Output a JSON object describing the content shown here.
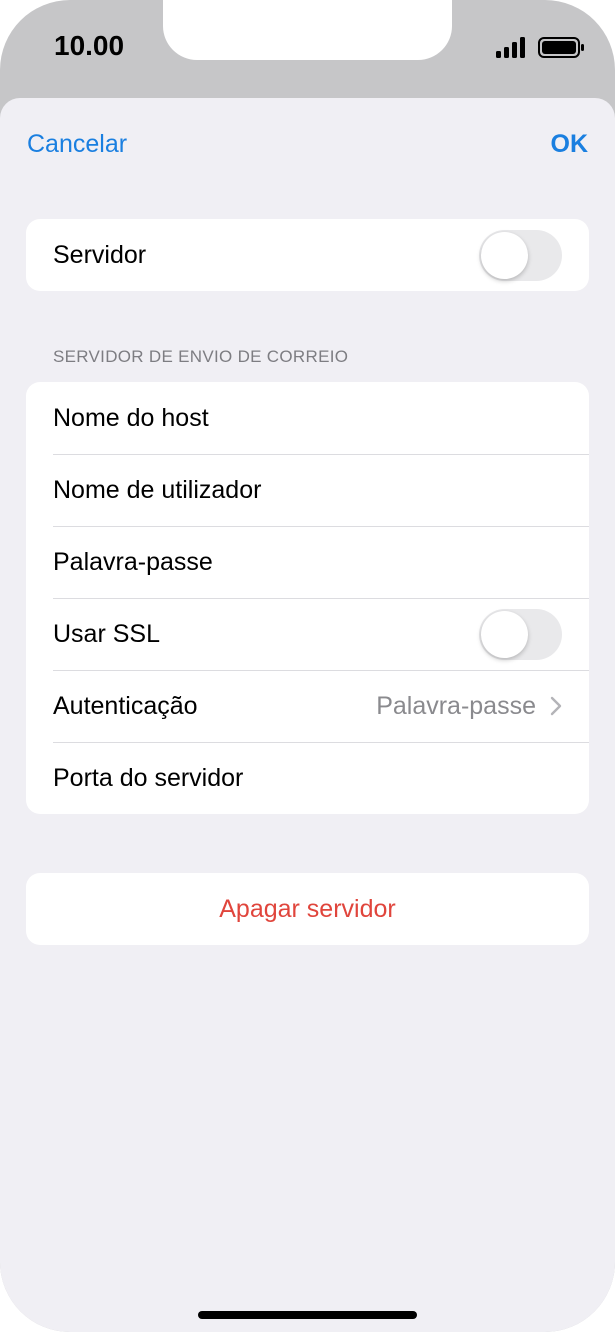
{
  "status_bar": {
    "time": "10.00",
    "icons": [
      "signal-icon",
      "battery-icon"
    ]
  },
  "nav": {
    "cancel_label": "Cancelar",
    "ok_label": "OK"
  },
  "server_toggle": {
    "label": "Servidor",
    "on": false
  },
  "outgoing_section": {
    "header": "SERVIDOR DE ENVIO DE CORREIO",
    "rows": [
      {
        "label": "Nome do host"
      },
      {
        "label": "Nome de utilizador"
      },
      {
        "label": "Palavra-passe"
      },
      {
        "label": "Usar SSL",
        "toggle_on": false
      },
      {
        "label": "Autenticação",
        "value": "Palavra-passe"
      },
      {
        "label": "Porta do servidor"
      }
    ]
  },
  "delete": {
    "label": "Apagar servidor"
  },
  "colors": {
    "accent": "#1a7fe0",
    "destructive": "#e0453c",
    "background": "#f0eff4",
    "secondary_text": "#8a8a8e"
  }
}
